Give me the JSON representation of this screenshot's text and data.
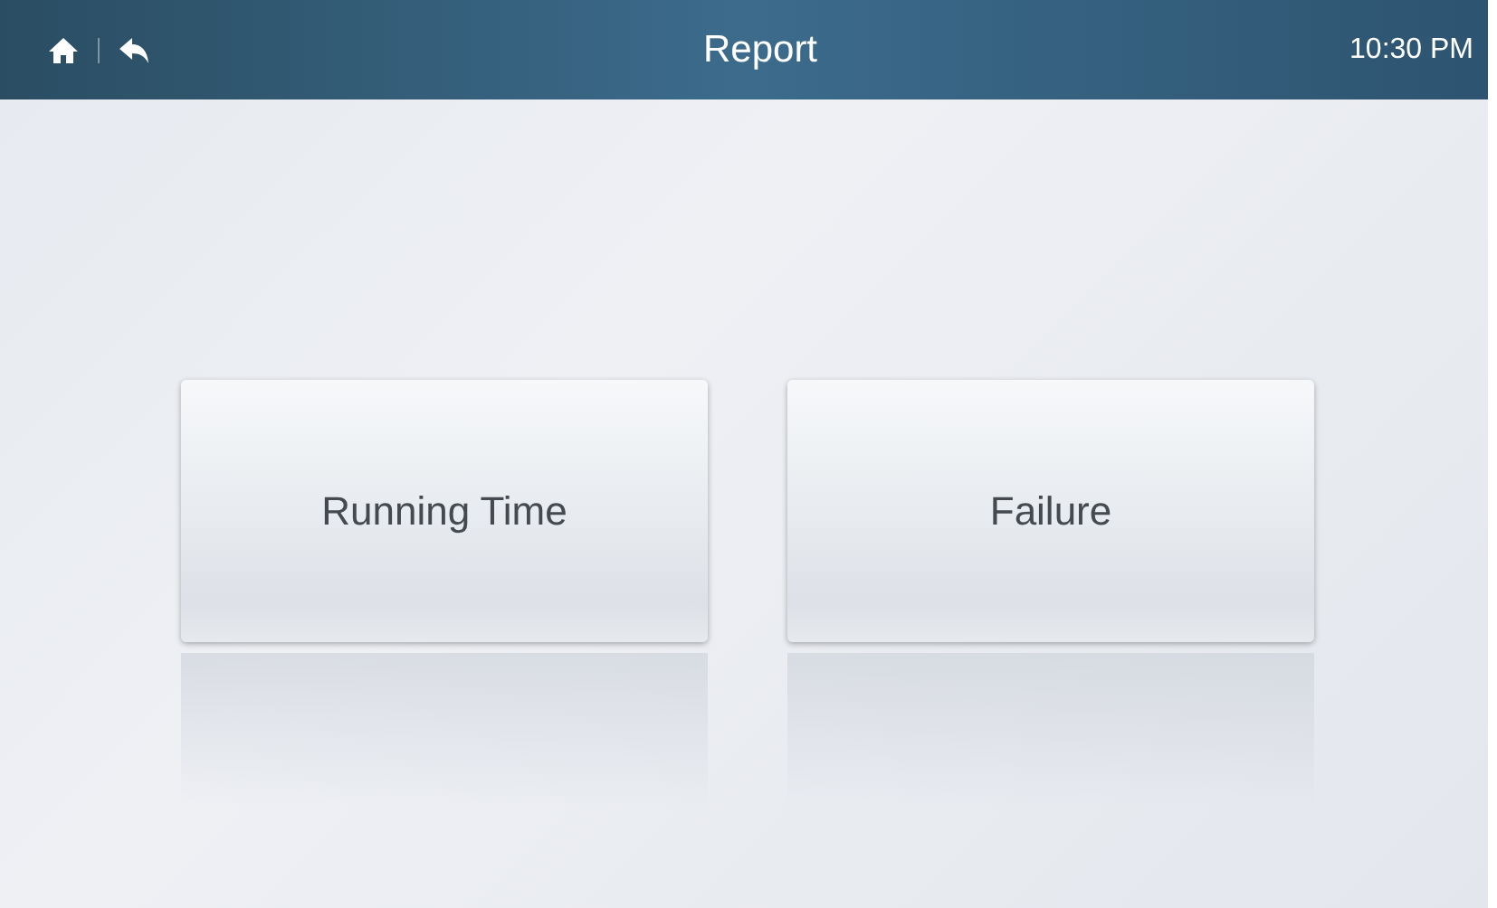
{
  "header": {
    "title": "Report",
    "time": "10:30 PM"
  },
  "buttons": [
    {
      "label": "Running Time"
    },
    {
      "label": "Failure"
    }
  ]
}
